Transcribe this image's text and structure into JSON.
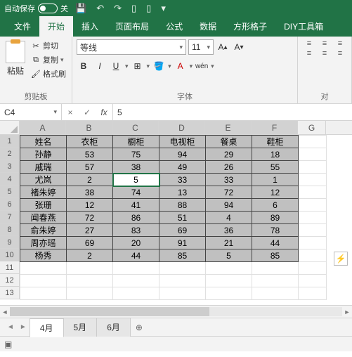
{
  "titlebar": {
    "autosave_label": "自动保存",
    "autosave_state": "关"
  },
  "tabs": [
    "文件",
    "开始",
    "插入",
    "页面布局",
    "公式",
    "数据",
    "方形格子",
    "DIY工具箱"
  ],
  "active_tab_index": 1,
  "ribbon": {
    "clipboard": {
      "label": "剪贴板",
      "paste": "粘贴",
      "cut": "剪切",
      "copy": "复制",
      "painter": "格式刷"
    },
    "font": {
      "label": "字体",
      "name": "等线",
      "size": "11",
      "bold": "B",
      "italic": "I",
      "underline": "U",
      "wen": "wén"
    },
    "align": {
      "label": "对"
    }
  },
  "namebox": "C4",
  "formula": "5",
  "columns": [
    "A",
    "B",
    "C",
    "D",
    "E",
    "F",
    "G"
  ],
  "rows": [
    "1",
    "2",
    "3",
    "4",
    "5",
    "6",
    "7",
    "8",
    "9",
    "10",
    "11",
    "12",
    "13"
  ],
  "active_cell": {
    "row": 3,
    "col": 2
  },
  "data_cols": 6,
  "data_rows": 10,
  "table": [
    [
      "姓名",
      "衣柜",
      "橱柜",
      "电视柜",
      "餐桌",
      "鞋柜"
    ],
    [
      "孙静",
      "53",
      "75",
      "94",
      "29",
      "18"
    ],
    [
      "戚瑞",
      "57",
      "38",
      "49",
      "26",
      "55"
    ],
    [
      "尤岚",
      "2",
      "5",
      "33",
      "33",
      "1"
    ],
    [
      "褚朱婷",
      "38",
      "74",
      "13",
      "72",
      "12"
    ],
    [
      "张珊",
      "12",
      "41",
      "88",
      "94",
      "6"
    ],
    [
      "闻春燕",
      "72",
      "86",
      "51",
      "4",
      "89"
    ],
    [
      "俞朱婷",
      "27",
      "83",
      "69",
      "36",
      "78"
    ],
    [
      "周亦瑶",
      "69",
      "20",
      "91",
      "21",
      "44"
    ],
    [
      "杨秀",
      "2",
      "44",
      "85",
      "5",
      "85"
    ]
  ],
  "sheets": [
    "4月",
    "5月",
    "6月"
  ],
  "active_sheet_index": 0
}
